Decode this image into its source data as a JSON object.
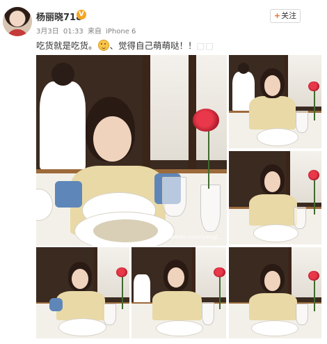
{
  "user": {
    "name": "杨丽晓718",
    "verified_icon": "verified-v-icon",
    "verified_glyph": "V",
    "follow_plus": "+",
    "follow_label": "关注"
  },
  "meta": {
    "date": "3月3日",
    "time": "01:33",
    "source_prefix": "来自",
    "source": "iPhone 6"
  },
  "post": {
    "text_before": "吃货就是吃货。",
    "emoji": "embarrassed-face-icon",
    "text_after": "、觉得自己萌萌哒！！",
    "tail": "□□"
  },
  "photos": {
    "count": 9,
    "watermark": "weibo.com/yangl..."
  },
  "colors": {
    "brand": "#f26a1b",
    "verified": "#f5a623",
    "text": "#333333",
    "meta": "#808080"
  }
}
